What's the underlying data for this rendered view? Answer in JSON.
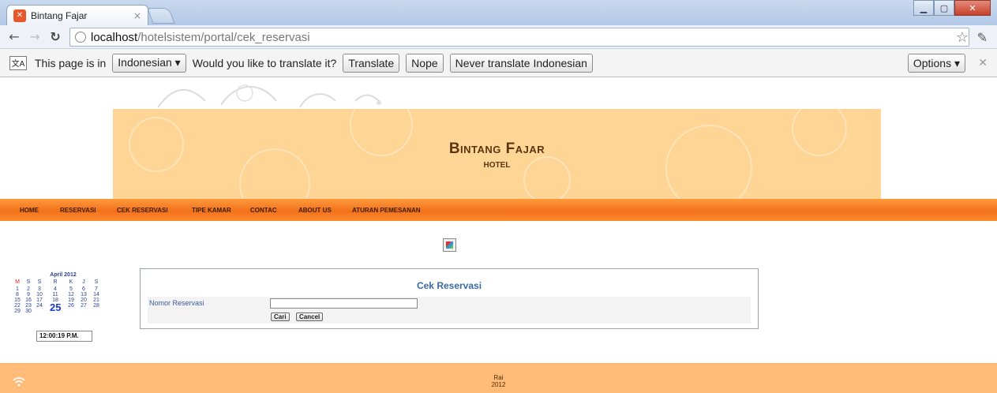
{
  "browser": {
    "tab_title": "Bintang Fajar",
    "url_host": "localhost",
    "url_path": "/hotelsistem/portal/cek_reservasi"
  },
  "infobar": {
    "text_prefix": "This page is in",
    "language": "Indonesian ▾",
    "question": "Would you like to translate it?",
    "translate": "Translate",
    "nope": "Nope",
    "never": "Never translate Indonesian",
    "options": "Options ▾"
  },
  "header": {
    "title": "Bintang Fajar",
    "subtitle": "HOTEL"
  },
  "menu": [
    "HOME",
    "RESERVASI",
    "CEK RESERVASI",
    "TIPE KAMAR",
    "CONTAC",
    "ABOUT US",
    "ATURAN PEMESANAN"
  ],
  "calendar": {
    "month": "April 2012",
    "weekdays": [
      "M",
      "S",
      "S",
      "R",
      "K",
      "J",
      "S"
    ],
    "weeks": [
      [
        "1",
        "2",
        "3",
        "4",
        "5",
        "6",
        "7"
      ],
      [
        "8",
        "9",
        "10",
        "11",
        "12",
        "13",
        "14"
      ],
      [
        "15",
        "16",
        "17",
        "18",
        "19",
        "20",
        "21"
      ],
      [
        "22",
        "23",
        "24",
        "25",
        "26",
        "27",
        "28"
      ],
      [
        "29",
        "30",
        "",
        "",
        "",
        "",
        ""
      ]
    ],
    "today": "25",
    "clock": "12:00:19 P.M."
  },
  "form": {
    "title": "Cek Reservasi",
    "label": "Nomor Reservasi",
    "input_value": "",
    "cari": "Cari",
    "cancel": "Cancel"
  },
  "footer": {
    "line1": "Rai",
    "line2": "2012"
  },
  "colors": {
    "header_bg": "#ffd595",
    "menu_bg": "#f2711b",
    "footer_bg": "#ffbb77",
    "title_blue": "#3b6aa5"
  }
}
